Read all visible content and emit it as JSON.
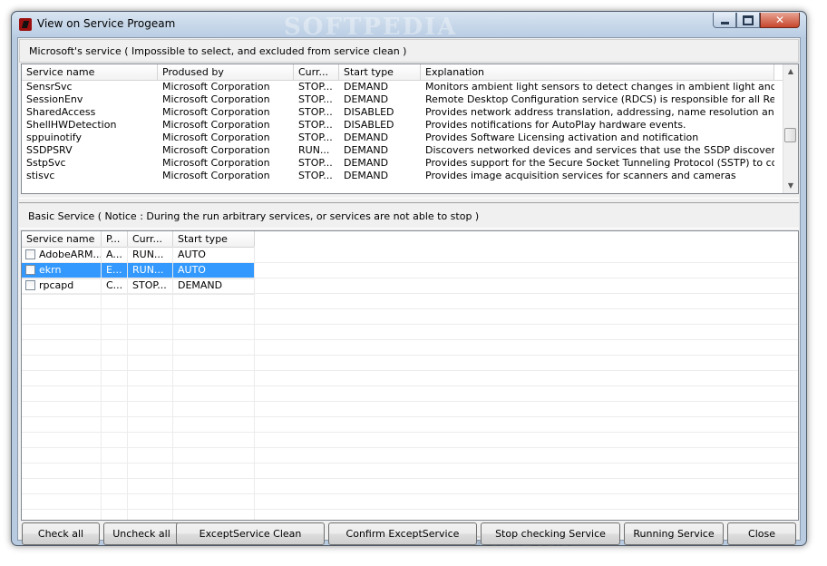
{
  "window": {
    "title": "View on Service Progeam",
    "watermark": "SOFTPEDIA"
  },
  "microsoft_section": {
    "label": "Microsoft's service ( Impossible to select, and excluded from service clean )",
    "columns": [
      "Service name",
      "Prodused by",
      "Curr...",
      "Start type",
      "Explanation"
    ],
    "rows": [
      [
        "SensrSvc",
        "Microsoft Corporation",
        "STOP...",
        "DEMAND",
        "Monitors ambient light sensors to detect changes in ambient light and adjust..."
      ],
      [
        "SessionEnv",
        "Microsoft Corporation",
        "STOP...",
        "DEMAND",
        "Remote Desktop Configuration service (RDCS) is responsible for all Remote ..."
      ],
      [
        "SharedAccess",
        "Microsoft Corporation",
        "STOP...",
        "DISABLED",
        "Provides network address translation, addressing, name resolution and/or in..."
      ],
      [
        "ShellHWDetection",
        "Microsoft Corporation",
        "STOP...",
        "DISABLED",
        "Provides notifications for AutoPlay hardware events."
      ],
      [
        "sppuinotify",
        "Microsoft Corporation",
        "STOP...",
        "DEMAND",
        "Provides Software Licensing activation and notification"
      ],
      [
        "SSDPSRV",
        "Microsoft Corporation",
        "RUN...",
        "DEMAND",
        "Discovers networked devices and services that use the SSDP discovery prot..."
      ],
      [
        "SstpSvc",
        "Microsoft Corporation",
        "STOP...",
        "DEMAND",
        "Provides support for the Secure Socket Tunneling Protocol (SSTP) to connec..."
      ],
      [
        "stisvc",
        "Microsoft Corporation",
        "STOP...",
        "DEMAND",
        "Provides image acquisition services for scanners and cameras"
      ]
    ]
  },
  "basic_section": {
    "label": "Basic Service ( Notice : During the run arbitrary services, or services are not able to stop )",
    "columns": [
      "Service name",
      "P...",
      "Curr...",
      "Start type"
    ],
    "rows": [
      {
        "name": "AdobeARM...",
        "p": "A...",
        "curr": "RUN...",
        "start": "AUTO",
        "selected": false
      },
      {
        "name": "ekrn",
        "p": "E...",
        "curr": "RUN...",
        "start": "AUTO",
        "selected": true
      },
      {
        "name": "rpcapd",
        "p": "C...",
        "curr": "STOP...",
        "start": "DEMAND",
        "selected": false
      }
    ]
  },
  "buttons": {
    "check_all": "Check all",
    "uncheck_all": "Uncheck all",
    "except_clean": "ExceptService Clean",
    "confirm_except": "Confirm ExceptService",
    "stop_checking": "Stop checking Service",
    "running": "Running Service",
    "close": "Close"
  },
  "colors": {
    "selection": "#3399ff",
    "window_frame": "#b9cbe0",
    "close_button": "#c7462b"
  }
}
